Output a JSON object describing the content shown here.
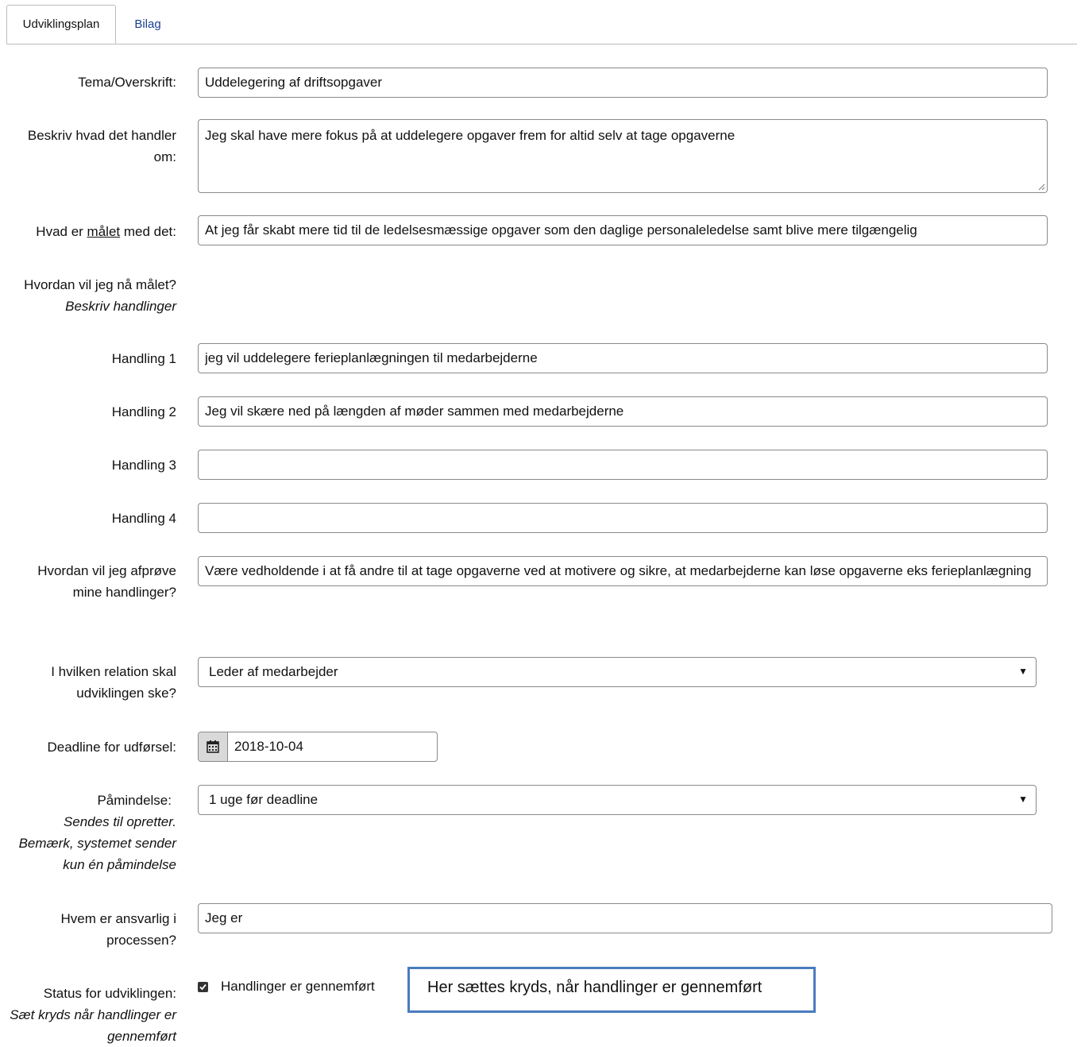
{
  "tabs": {
    "active": "Udviklingsplan",
    "link": "Bilag"
  },
  "form": {
    "tema_label": "Tema/Overskrift:",
    "tema_value": "Uddelegering af driftsopgaver",
    "beskriv_label": "Beskriv hvad det handler om:",
    "beskriv_value": "Jeg skal have mere fokus på at uddelegere opgaver frem for altid selv at tage opgaverne",
    "maal_label_pre": "Hvad er ",
    "maal_label_u": "målet",
    "maal_label_post": " med det:",
    "maal_value": "At jeg får skabt mere tid til de ledelsesmæssige opgaver som den daglige personaleledelse samt blive mere tilgængelig",
    "hvordan_label": "Hvordan vil jeg nå målet?",
    "hvordan_sub": "Beskriv handlinger",
    "handlinger": [
      {
        "label": "Handling 1",
        "value": "jeg vil uddelegere ferieplanlægningen til medarbejderne"
      },
      {
        "label": "Handling 2",
        "value": "Jeg vil skære ned på længden af møder sammen med medarbejderne"
      },
      {
        "label": "Handling 3",
        "value": ""
      },
      {
        "label": "Handling 4",
        "value": ""
      }
    ],
    "afproeve_label": "Hvordan vil jeg afprøve mine handlinger?",
    "afproeve_value": "Være vedholdende i at få andre til at tage opgaverne ved at motivere og sikre, at medarbejderne kan løse opgaverne eks ferieplanlægning",
    "relation_label": "I hvilken relation skal udviklingen ske?",
    "relation_value": "Leder af medarbejder",
    "deadline_label": "Deadline for udførsel:",
    "deadline_value": "2018-10-04",
    "paamindelse_label": "Påmindelse:",
    "paamindelse_sub": "Sendes til opretter. Bemærk, systemet sender kun én påmindelse",
    "paamindelse_value": "1 uge før deadline",
    "ansvarlig_label": "Hvem er ansvarlig i processen?",
    "ansvarlig_value": "Jeg er",
    "status_label": "Status for udviklingen:",
    "status_sub": "Sæt kryds når handlinger er gennemført",
    "status_checkbox_label": "Handlinger er gennemført",
    "status_checked": true
  },
  "callout": {
    "text": "Her sættes kryds, når handlinger er gennemført",
    "border_color": "#4a7cbf"
  },
  "icons": {
    "calendar": "calendar-icon",
    "dropdown": "triangle-down-icon",
    "check": "check-icon"
  }
}
